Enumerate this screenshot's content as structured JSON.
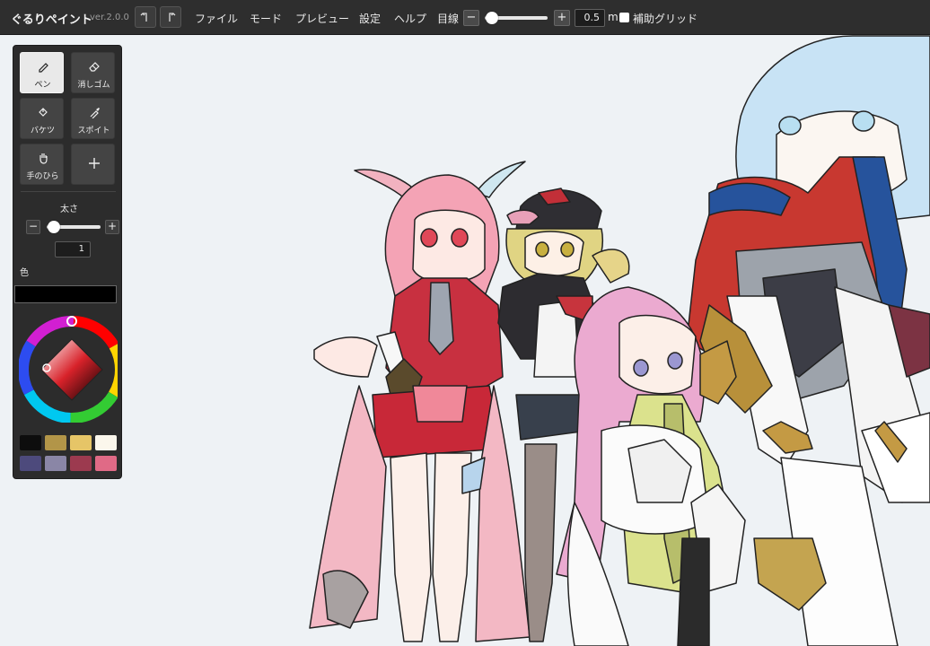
{
  "app": {
    "title": "ぐるりペイント",
    "version": "ver.2.0.0"
  },
  "menu": [
    "ファイル",
    "モード",
    "プレビュー",
    "設定",
    "ヘルプ"
  ],
  "guide": {
    "label": "目線",
    "minus": "−",
    "plus": "+",
    "value": "0.5",
    "unit": "m",
    "grid_label": "補助グリッド"
  },
  "tools": [
    {
      "label": "ペン",
      "icon": "pen-icon",
      "active": true
    },
    {
      "label": "消しゴム",
      "icon": "eraser-icon",
      "active": false
    },
    {
      "label": "バケツ",
      "icon": "bucket-icon",
      "active": false
    },
    {
      "label": "スポイト",
      "icon": "eyedropper-icon",
      "active": false
    },
    {
      "label": "手のひら",
      "icon": "hand-icon",
      "active": false
    },
    {
      "label": "",
      "icon": "plus-icon",
      "active": false
    }
  ],
  "brush": {
    "label": "太さ",
    "minus": "−",
    "plus": "+",
    "value": "1"
  },
  "color": {
    "label": "色",
    "current": "#000000"
  },
  "palette": [
    "#0d0d0d",
    "#b29548",
    "#e6c567",
    "#fbf7ec",
    "#4d4a7c",
    "#8a86a6",
    "#9c3a4f",
    "#e06a86"
  ],
  "colors": {
    "canvas_bg": "#eef2f5",
    "toolbar_bg": "#2e2e2e",
    "panel_bg": "#2c2c2c"
  }
}
